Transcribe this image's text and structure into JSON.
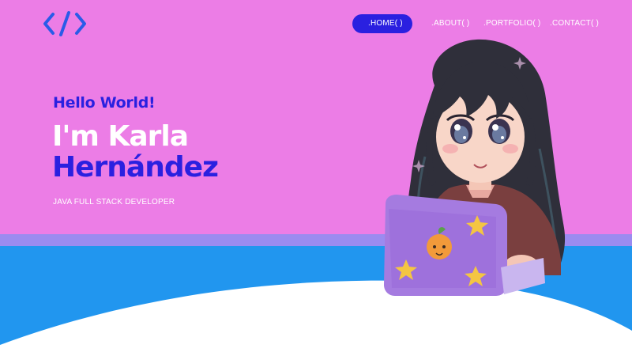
{
  "nav": {
    "items": [
      ".HOME( )",
      ".ABOUT( )",
      ".PORTFOLIO( )",
      ".CONTACT( )"
    ],
    "active_index": 0
  },
  "hero": {
    "greeting": "Hello World!",
    "name_line1": "I'm Karla",
    "name_line2": "Hernández",
    "role": "JAVA FULL STACK DEVELOPER"
  },
  "colors": {
    "background": "#ec7de6",
    "accent_blue": "#2a20e0",
    "band_blue": "#2196ef",
    "band_light": "#9b8bf0",
    "wave": "#ffffff"
  },
  "icons": {
    "logo": "code-brackets-icon"
  }
}
